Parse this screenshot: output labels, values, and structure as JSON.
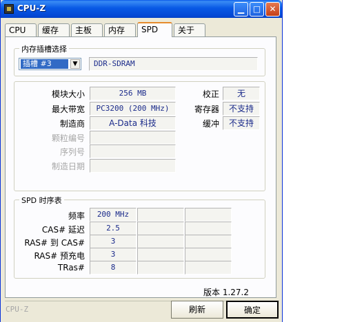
{
  "window": {
    "title": "CPU-Z",
    "controls": {
      "minimize": "▁",
      "maximize": "□",
      "close": "✕"
    }
  },
  "tabs": [
    "CPU",
    "缓存",
    "主板",
    "内存",
    "SPD",
    "关于"
  ],
  "active_tab": "SPD",
  "slot_group": {
    "label": "内存插槽选择",
    "selected_slot": "插槽 #3",
    "module_type": "DDR-SDRAM"
  },
  "module_info": {
    "rows": [
      {
        "label": "模块大小",
        "value": "256 MB",
        "disabled": false
      },
      {
        "label": "最大带宽",
        "value": "PC3200 (200 MHz)",
        "disabled": false
      },
      {
        "label": "制造商",
        "value": "A-Data 科技",
        "disabled": false
      },
      {
        "label": "颗粒编号",
        "value": "",
        "disabled": true
      },
      {
        "label": "序列号",
        "value": "",
        "disabled": true
      },
      {
        "label": "制造日期",
        "value": "",
        "disabled": true
      }
    ],
    "right_rows": [
      {
        "label": "校正",
        "value": "无"
      },
      {
        "label": "寄存器",
        "value": "不支持"
      },
      {
        "label": "缓冲",
        "value": "不支持"
      }
    ]
  },
  "timing_group": {
    "label": "SPD 时序表",
    "rows": [
      {
        "label": "频率",
        "value": "200 MHz"
      },
      {
        "label": "CAS# 延迟",
        "value": "2.5"
      },
      {
        "label": "RAS# 到 CAS#",
        "value": "3"
      },
      {
        "label": "RAS# 预充电",
        "value": "3"
      },
      {
        "label": "TRas#",
        "value": "8"
      }
    ]
  },
  "version": "版本 1.27.2",
  "status_text": "CPU-Z",
  "buttons": {
    "refresh": "刷新",
    "ok": "确定"
  }
}
